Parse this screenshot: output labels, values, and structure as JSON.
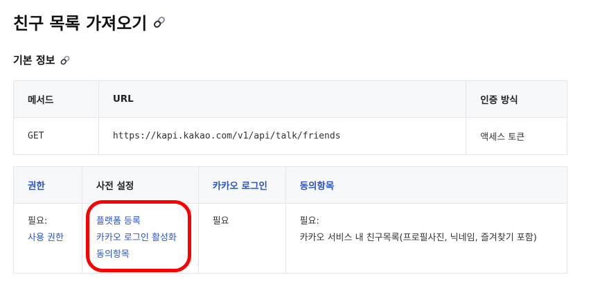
{
  "page": {
    "title": "친구 목록 가져오기",
    "section_title": "기본 정보"
  },
  "icons": {
    "title_anchor": "link-icon",
    "section_anchor": "link-icon"
  },
  "basic_info": {
    "headers": [
      "메서드",
      "URL",
      "인증 방식"
    ],
    "row": {
      "method": "GET",
      "url": "https://kapi.kakao.com/v1/api/talk/friends",
      "auth": "액세스 토큰"
    }
  },
  "requirements": {
    "headers": {
      "permission": "권한",
      "prerequisites": "사전 설정",
      "kakao_login": "카카오 로그인",
      "consent": "동의항목"
    },
    "row": {
      "permission_label": "필요:",
      "permission_link": "사용 권한",
      "prereq_links": [
        "플랫폼 등록",
        "카카오 로그인 활성화",
        "동의항목"
      ],
      "kakao_login_value": "필요",
      "consent_label": "필요:",
      "consent_value": "카카오 서비스 내 친구목록(프로필사진, 닉네임, 즐겨찾기 포함)"
    }
  },
  "colors": {
    "link": "#2a55c8",
    "header_bg": "#f7f8fa",
    "border": "#e3e5e8",
    "highlight": "#ff0000"
  }
}
